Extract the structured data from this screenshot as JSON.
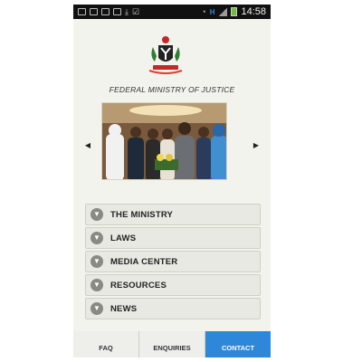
{
  "status_bar": {
    "time": "14:58",
    "notification_icons": [
      "chat-icon",
      "message-icon",
      "mail-icon",
      "mail-icon",
      "download-icon",
      "check-icon"
    ],
    "system_icons": [
      "wifi-icon",
      "data-icon",
      "signal-icon",
      "battery-icon"
    ]
  },
  "header": {
    "logo_icon": "nigeria-coat-of-arms-icon",
    "title": "FEDERAL MINISTRY OF JUSTICE"
  },
  "slideshow": {
    "prev_icon": "arrow-left-icon",
    "next_icon": "arrow-right-icon"
  },
  "menu": {
    "items": [
      {
        "label": "THE MINISTRY",
        "icon": "chevron-down-icon"
      },
      {
        "label": "LAWS",
        "icon": "chevron-down-icon"
      },
      {
        "label": "MEDIA CENTER",
        "icon": "chevron-down-icon"
      },
      {
        "label": "RESOURCES",
        "icon": "chevron-down-icon"
      },
      {
        "label": "NEWS",
        "icon": "chevron-down-icon"
      }
    ]
  },
  "tabs": [
    {
      "label": "FAQ",
      "active": false
    },
    {
      "label": "ENQUIRIES",
      "active": false
    },
    {
      "label": "CONTACT",
      "active": true
    }
  ],
  "colors": {
    "accent": "#2e87d8",
    "background": "#f2f3ed",
    "status_bar": "#111111"
  }
}
